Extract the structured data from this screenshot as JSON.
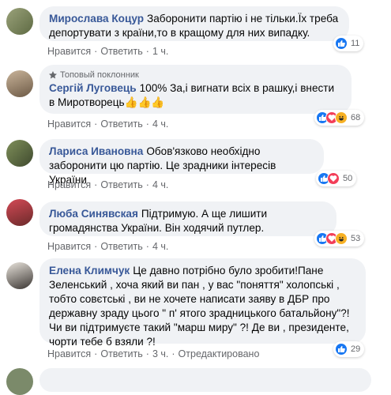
{
  "comments": [
    {
      "author": "Мирослава Коцур",
      "text": "Заборонити партію і не тільки.Їх треба депортувати з країни,то в кращому для них випадку.",
      "actions": {
        "like": "Нравится",
        "reply": "Ответить",
        "time": "1 ч."
      },
      "reactions": {
        "count": "11"
      }
    },
    {
      "badge": "Топовый поклонник",
      "author": "Сергій Луговець",
      "text": "100% За,і вигнати всіх в рашку,і внести в Миротворець👍👍👍",
      "actions": {
        "like": "Нравится",
        "reply": "Ответить",
        "time": "4 ч."
      },
      "reactions": {
        "count": "68"
      }
    },
    {
      "author": "Лариса Ивановна",
      "text": "Обов'язково необхідно заборонити цю партію. Це зрадники інтересів України",
      "actions": {
        "like": "Нравится",
        "reply": "Ответить",
        "time": "4 ч."
      },
      "reactions": {
        "count": "50"
      }
    },
    {
      "author": "Люба Синявская",
      "text": "Підтримую. А ще лишити громадянства України. Він ходячий путлер.",
      "actions": {
        "like": "Нравится",
        "reply": "Ответить",
        "time": "4 ч."
      },
      "reactions": {
        "count": "53"
      }
    },
    {
      "author": "Елена Климчук",
      "text": "Це давно потрібно було зробити!Пане Зеленський , хоча який ви пан , у вас \"поняття\" холопські , тобто совєтські , ви не хочете написати заяву в ДБР про державну зраду цього \" п' ятого зрадницького батальйону\"?! Чи ви підтримуєте такий \"марш миру\" ?! Де ви , президенте, чорти тебе б взяли ?!",
      "actions": {
        "like": "Нравится",
        "reply": "Ответить",
        "time": "3 ч.",
        "edited": "Отредактировано"
      },
      "reactions": {
        "count": "29"
      }
    }
  ],
  "colors": {
    "author": "#385898",
    "bubble": "#f0f2f5",
    "meta": "#65676b",
    "like": "#1877f2",
    "love": "#f33e58",
    "haha": "#f7b125"
  }
}
